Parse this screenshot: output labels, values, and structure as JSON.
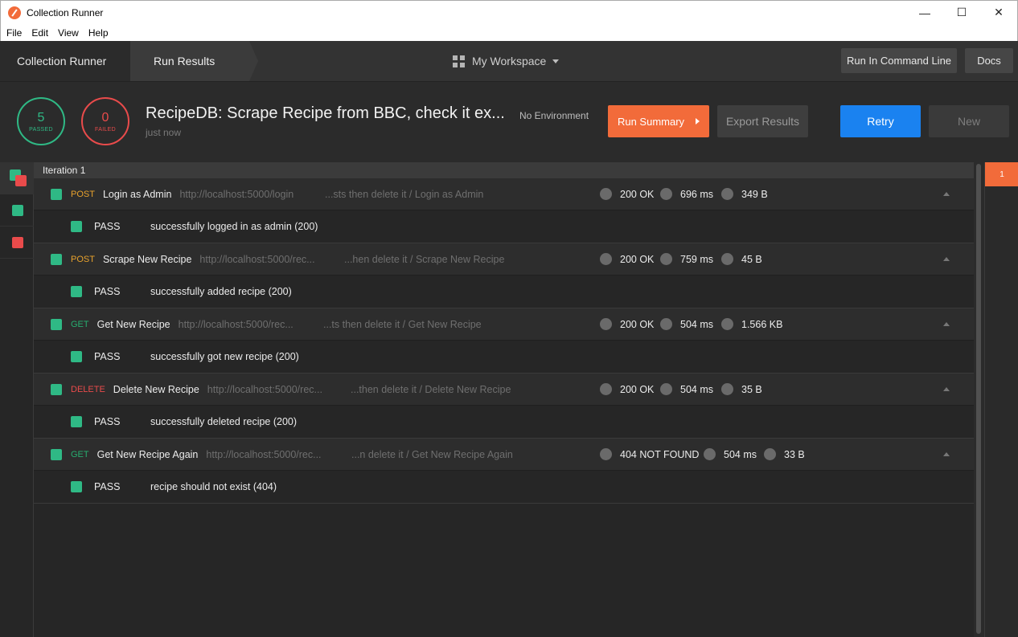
{
  "window": {
    "title": "Collection Runner",
    "minimize": "—",
    "maximize": "☐",
    "close": "✕"
  },
  "menu": [
    "File",
    "Edit",
    "View",
    "Help"
  ],
  "header": {
    "breadcrumb_1": "Collection Runner",
    "breadcrumb_2": "Run Results",
    "workspace": "My Workspace",
    "run_cli_label": "Run In Command Line",
    "docs_label": "Docs"
  },
  "summary": {
    "passed_count": "5",
    "passed_label": "PASSED",
    "failed_count": "0",
    "failed_label": "FAILED",
    "run_title": "RecipeDB: Scrape Recipe from BBC, check it ex...",
    "run_time": "just now",
    "environment": "No Environment",
    "run_summary_label": "Run Summary",
    "export_label": "Export Results",
    "retry_label": "Retry",
    "new_label": "New"
  },
  "colors": {
    "pass": "#2fb985",
    "fail": "#e94b4b",
    "accent": "#f26b3a",
    "primary": "#1a82f0",
    "post": "#e8a22d",
    "get": "#27ad6f",
    "delete": "#e94b4b"
  },
  "iteration": {
    "label": "Iteration 1",
    "tab": "1"
  },
  "requests": [
    {
      "method": "POST",
      "name": "Login as Admin",
      "url": "http://localhost:5000/login",
      "path": "...sts then delete it / Login as Admin",
      "status": "200 OK",
      "time": "696 ms",
      "size": "349 B",
      "test_result": "PASS",
      "test_name": "successfully logged in as admin (200)"
    },
    {
      "method": "POST",
      "name": "Scrape New Recipe",
      "url": "http://localhost:5000/rec...",
      "path": "...hen delete it / Scrape New Recipe",
      "status": "200 OK",
      "time": "759 ms",
      "size": "45 B",
      "test_result": "PASS",
      "test_name": "successfully added recipe (200)"
    },
    {
      "method": "GET",
      "name": "Get New Recipe",
      "url": "http://localhost:5000/rec...",
      "path": "...ts then delete it / Get New Recipe",
      "status": "200 OK",
      "time": "504 ms",
      "size": "1.566 KB",
      "test_result": "PASS",
      "test_name": "successfully got new recipe (200)"
    },
    {
      "method": "DELETE",
      "name": "Delete New Recipe",
      "url": "http://localhost:5000/rec...",
      "path": "...then delete it / Delete New Recipe",
      "status": "200 OK",
      "time": "504 ms",
      "size": "35 B",
      "test_result": "PASS",
      "test_name": "successfully deleted recipe (200)"
    },
    {
      "method": "GET",
      "name": "Get New Recipe Again",
      "url": "http://localhost:5000/rec...",
      "path": "...n delete it / Get New Recipe Again",
      "status": "404 NOT FOUND",
      "time": "504 ms",
      "size": "33 B",
      "test_result": "PASS",
      "test_name": "recipe should not exist (404)"
    }
  ]
}
